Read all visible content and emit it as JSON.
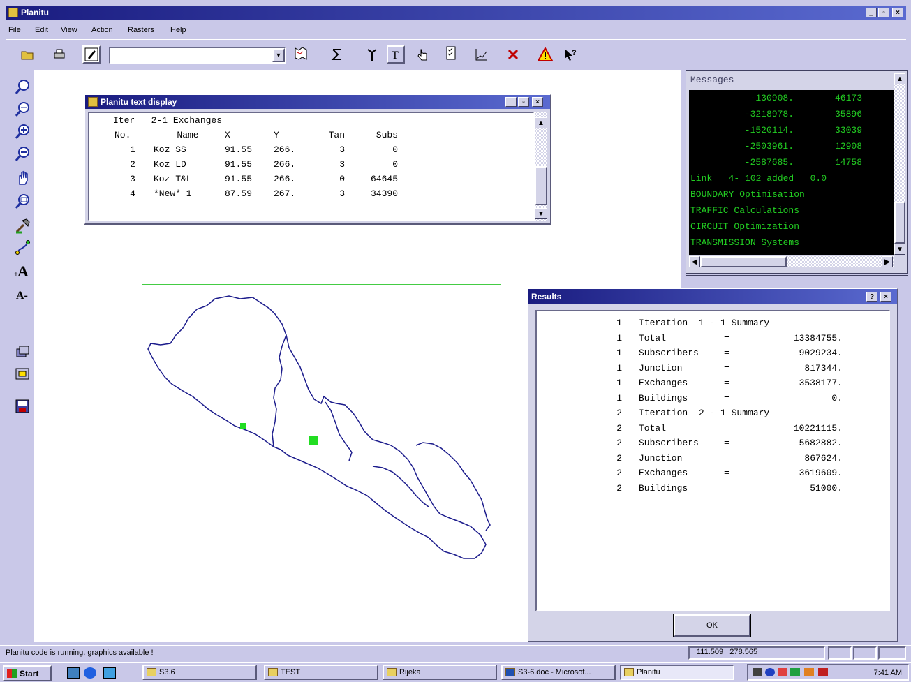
{
  "window": {
    "title": "Planitu"
  },
  "menu": [
    "File",
    "Edit",
    "View",
    "Action",
    "Rasters",
    "Help"
  ],
  "toolbar": {
    "combo_value": ""
  },
  "text_display": {
    "title": "Planitu text display",
    "header_line": "Iter   2-1 Exchanges",
    "columns": [
      "No.",
      "Name",
      "X",
      "Y",
      "Tan",
      "Subs"
    ],
    "rows": [
      [
        "1",
        "Koz SS",
        "91.55",
        "266.",
        "3",
        "0"
      ],
      [
        "2",
        "Koz LD",
        "91.55",
        "266.",
        "3",
        "0"
      ],
      [
        "3",
        "Koz T&L",
        "91.55",
        "266.",
        "0",
        "64645"
      ],
      [
        "4",
        "*New* 1",
        "87.59",
        "267.",
        "3",
        "34390"
      ]
    ]
  },
  "messages": {
    "title": "Messages",
    "lines": [
      [
        "-130908.",
        "46173"
      ],
      [
        "-3218978.",
        "35896"
      ],
      [
        "-1520114.",
        "33039"
      ],
      [
        "-2503961.",
        "12908"
      ],
      [
        "-2587685.",
        "14758"
      ]
    ],
    "text_lines": [
      "Link   4- 102 added   0.0",
      "BOUNDARY Optimisation",
      "TRAFFIC Calculations",
      "CIRCUIT Optimization",
      "TRANSMISSION Systems"
    ]
  },
  "results": {
    "title": "Results",
    "help_glyph": "?",
    "close_glyph": "×",
    "lines": [
      [
        "1",
        "Iteration  1 - 1 Summary",
        "",
        ""
      ],
      [
        "1",
        "Total",
        "=",
        "13384755."
      ],
      [
        "1",
        "Subscribers",
        "=",
        "9029234."
      ],
      [
        "1",
        "Junction",
        "=",
        "817344."
      ],
      [
        "1",
        "Exchanges",
        "=",
        "3538177."
      ],
      [
        "1",
        "Buildings",
        "=",
        "0."
      ],
      [
        "2",
        "Iteration  2 - 1 Summary",
        "",
        ""
      ],
      [
        "2",
        "Total",
        "=",
        "10221115."
      ],
      [
        "2",
        "Subscribers",
        "=",
        "5682882."
      ],
      [
        "2",
        "Junction",
        "=",
        "867624."
      ],
      [
        "2",
        "Exchanges",
        "=",
        "3619609."
      ],
      [
        "2",
        "Buildings",
        "=",
        "51000."
      ]
    ],
    "ok_label": "OK"
  },
  "status": {
    "message": "Planitu code is running, graphics available !",
    "coords": "111.509   278.565"
  },
  "taskbar": {
    "start_label": "Start",
    "items": [
      "S3.6",
      "TEST",
      "Rijeka",
      "S3-6.doc - Microsof...",
      "Planitu"
    ],
    "clock": "7:41 AM"
  },
  "colors": {
    "titlebar_start": "#1a1c80",
    "app_background": "#c9c8e8",
    "map_outline": "#1c1c8c",
    "map_frame": "#44cc44",
    "exchange_marker": "#22dd22",
    "console_bg": "#000000",
    "console_text": "#22cc22"
  }
}
